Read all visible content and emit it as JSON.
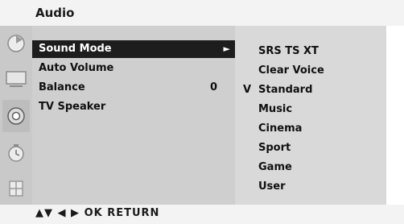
{
  "header": {
    "title": "Audio"
  },
  "sidebar": {
    "icons": [
      {
        "name": "picture-icon"
      },
      {
        "name": "screen-icon"
      },
      {
        "name": "audio-icon"
      },
      {
        "name": "time-icon"
      },
      {
        "name": "lock-icon"
      }
    ],
    "selected_index": 2
  },
  "menu": {
    "items": [
      {
        "label": "Sound Mode",
        "value": "",
        "arrow": "►"
      },
      {
        "label": "Auto Volume",
        "value": "",
        "arrow": ""
      },
      {
        "label": "Balance",
        "value": "0",
        "arrow": ""
      },
      {
        "label": "TV Speaker",
        "value": "",
        "arrow": ""
      }
    ]
  },
  "options": {
    "items": [
      "SRS TS XT",
      "Clear Voice",
      "Standard",
      "Music",
      "Cinema",
      "Sport",
      "Game",
      "User"
    ],
    "selected_index": 2,
    "check_mark": "V"
  },
  "footer": {
    "hint": "▲▼  ◀ ▶  OK  RETURN"
  },
  "colors": {
    "highlight": "#1d1d1d",
    "panel": "#d7d7d7",
    "header": "#f3f3f3"
  }
}
